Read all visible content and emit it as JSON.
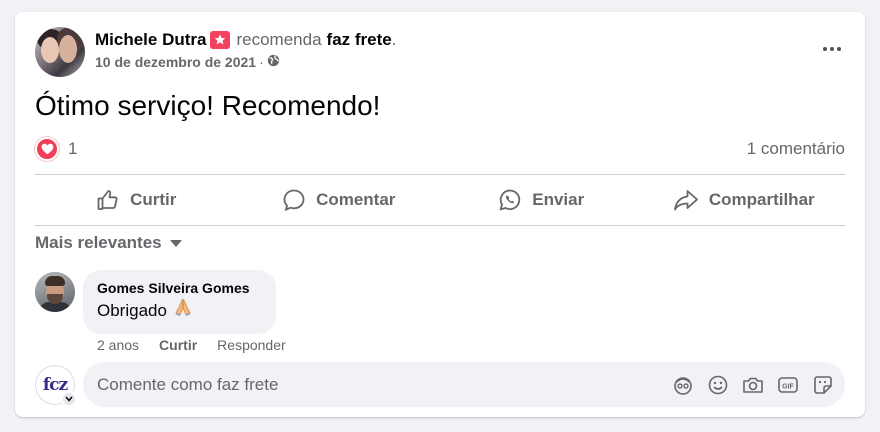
{
  "post": {
    "author": "Michele Dutra",
    "action_text": "recomenda",
    "page_name": "faz frete",
    "period": ".",
    "date": "10 de dezembro de 2021",
    "date_sep": "·",
    "text": "Ótimo serviço! Recomendo!",
    "reaction_count": "1",
    "comment_count": "1 comentário"
  },
  "actions": {
    "like": "Curtir",
    "comment": "Comentar",
    "send": "Enviar",
    "share": "Compartilhar"
  },
  "sort": {
    "label": "Mais relevantes"
  },
  "comment": {
    "author": "Gomes Silveira Gomes",
    "text": "Obrigado",
    "age": "2 anos",
    "like": "Curtir",
    "reply": "Responder"
  },
  "composer": {
    "avatar_text": "fcz",
    "placeholder": "Comente como faz frete"
  },
  "colors": {
    "love": "#f33e58",
    "recommend": "#f3425f",
    "muted": "#65676b"
  },
  "icons": [
    "recommend-badge-icon",
    "globe-icon",
    "more-icon",
    "love-reaction-icon",
    "like-icon",
    "comment-icon",
    "whatsapp-icon",
    "share-icon",
    "caret-down-icon",
    "pray-emoji-icon",
    "avatar-sticker-icon",
    "emoji-icon",
    "camera-icon",
    "gif-icon",
    "sticker-icon"
  ]
}
